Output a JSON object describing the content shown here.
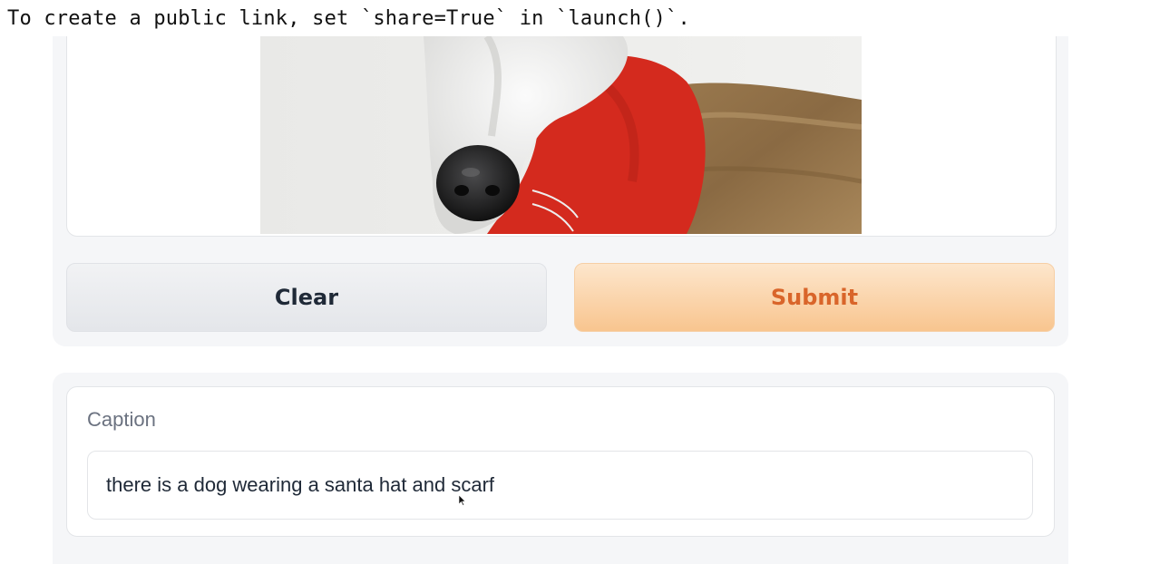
{
  "console": {
    "message": "To create a public link, set `share=True` in `launch()`."
  },
  "image_input": {
    "icon": "dog-photo"
  },
  "buttons": {
    "clear_label": "Clear",
    "submit_label": "Submit"
  },
  "output": {
    "label": "Caption",
    "value": "there is a dog wearing a santa hat and scarf"
  },
  "colors": {
    "submit_text": "#d9652a",
    "submit_bg": "#f8c58f",
    "clear_bg": "#e4e6ea",
    "scarf": "#d42a1e"
  }
}
